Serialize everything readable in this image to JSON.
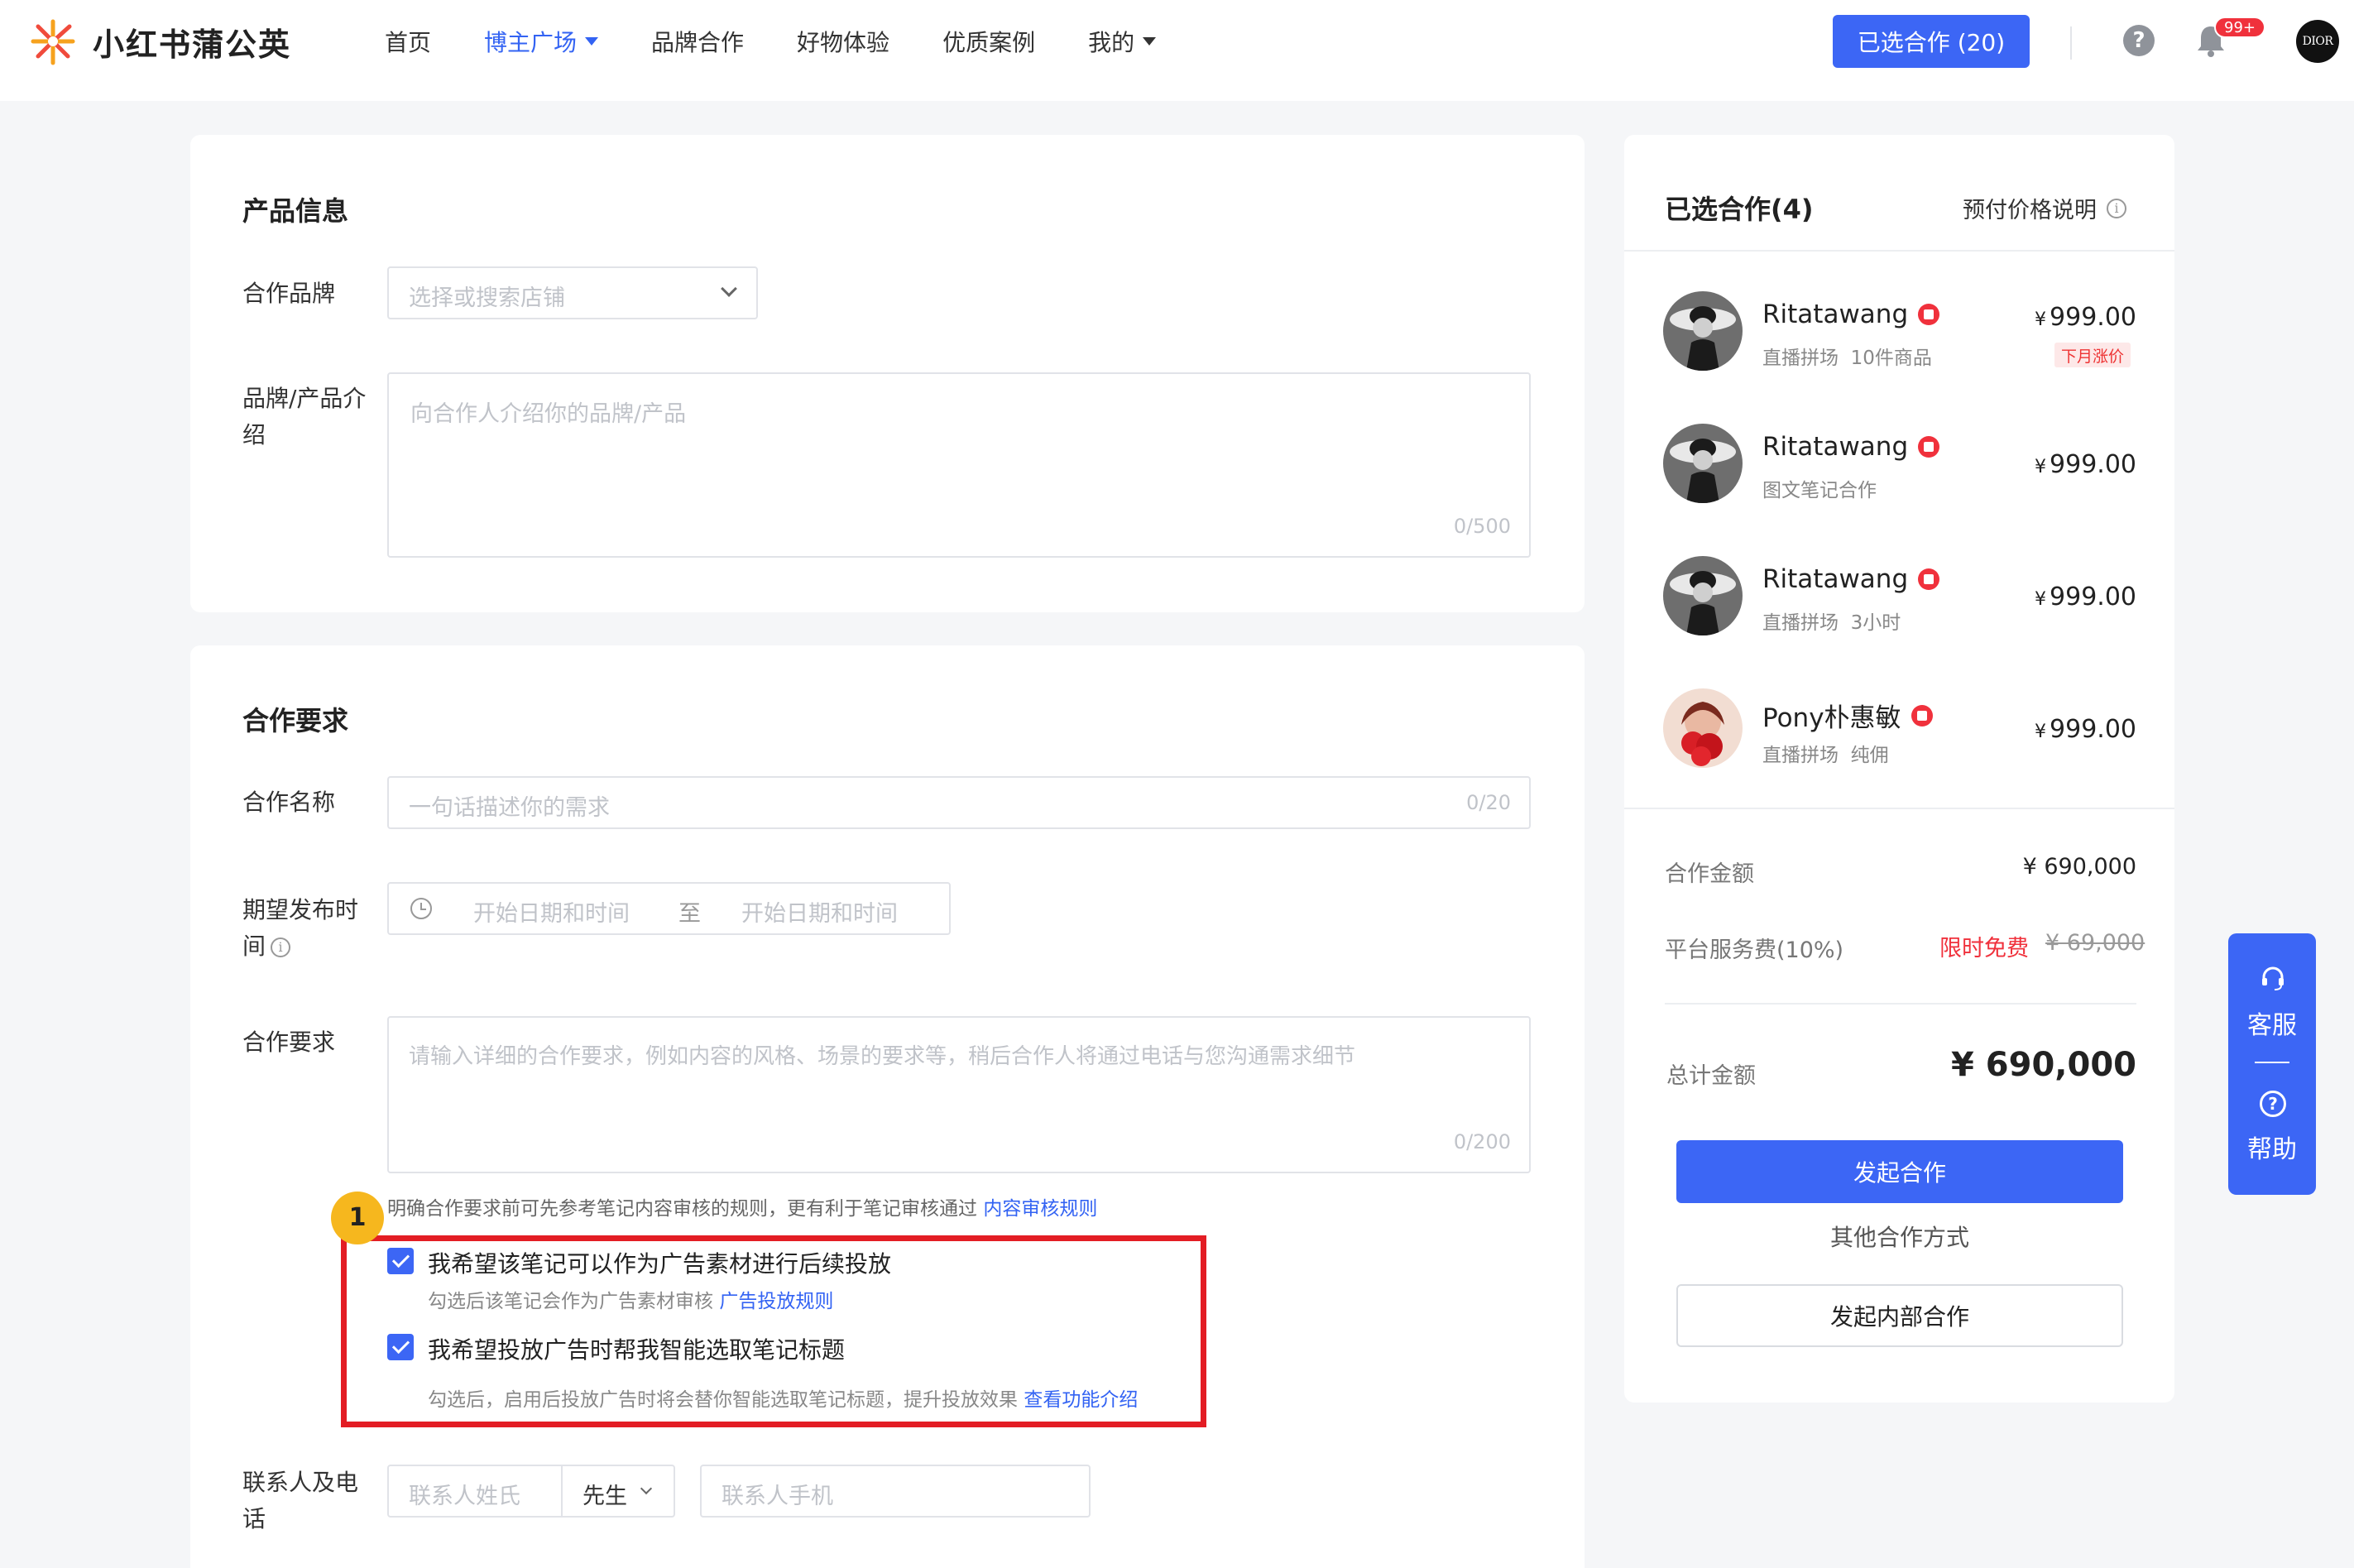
{
  "header": {
    "brand": "小红书蒲公英",
    "nav": [
      {
        "label": "首页",
        "active": false,
        "dropdown": false
      },
      {
        "label": "博主广场",
        "active": true,
        "dropdown": true
      },
      {
        "label": "品牌合作",
        "active": false,
        "dropdown": false
      },
      {
        "label": "好物体验",
        "active": false,
        "dropdown": false
      },
      {
        "label": "优质案例",
        "active": false,
        "dropdown": false
      },
      {
        "label": "我的",
        "active": false,
        "dropdown": true
      }
    ],
    "selected_button": "已选合作 (20)",
    "notification_badge": "99+",
    "help_glyph": "?",
    "avatar_text": "DIOR",
    "icons": [
      "dandelion-logo-icon",
      "help-icon",
      "bell-icon"
    ]
  },
  "product_section": {
    "title": "产品信息",
    "brand_field": {
      "label": "合作品牌",
      "placeholder": "选择或搜索店铺"
    },
    "intro_field": {
      "label": "品牌/产品介绍",
      "placeholder": "向合作人介绍你的品牌/产品",
      "counter": "0/500"
    }
  },
  "requirements_section": {
    "title": "合作要求",
    "name_field": {
      "label": "合作名称",
      "placeholder": "一句话描述你的需求",
      "counter": "0/20"
    },
    "time_field": {
      "label": "期望发布时间",
      "start_placeholder": "开始日期和时间",
      "separator": "至",
      "end_placeholder": "开始日期和时间"
    },
    "req_field": {
      "label": "合作要求",
      "placeholder": "请输入详细的合作要求，例如内容的风格、场景的要求等，稍后合作人将通过电话与您沟通需求细节",
      "counter": "0/200"
    },
    "review_hint": {
      "text": "明确合作要求前可先参考笔记内容审核的规则，更有利于笔记审核通过",
      "link": "内容审核规则"
    },
    "step_number": "1",
    "options": [
      {
        "checked": true,
        "label": "我希望该笔记可以作为广告素材进行后续投放",
        "sub": "勾选后该笔记会作为广告素材审核",
        "link": "广告投放规则"
      },
      {
        "checked": true,
        "label": "我希望投放广告时帮我智能选取笔记标题",
        "sub": "勾选后，启用后投放广告时将会替你智能选取笔记标题，提升投放效果",
        "link": "查看功能介绍"
      }
    ],
    "contact_field": {
      "label": "联系人及电话",
      "name_placeholder": "联系人姓氏",
      "title_value": "先生",
      "phone_placeholder": "联系人手机"
    }
  },
  "side_panel": {
    "title": "已选合作(4)",
    "price_note": "预付价格说明",
    "partners": [
      {
        "name": "Ritatawang",
        "type": "直播拼场",
        "detail": "10件商品",
        "price": "999.00",
        "currency": "¥",
        "tag": "下月涨价",
        "avatar": "bw"
      },
      {
        "name": "Ritatawang",
        "type": "图文笔记合作",
        "detail": "",
        "price": "999.00",
        "currency": "¥",
        "tag": "",
        "avatar": "bw"
      },
      {
        "name": "Ritatawang",
        "type": "直播拼场",
        "detail": "3小时",
        "price": "999.00",
        "currency": "¥",
        "tag": "",
        "avatar": "bw"
      },
      {
        "name": "Pony朴惠敏",
        "type": "直播拼场",
        "detail": "纯佣",
        "price": "999.00",
        "currency": "¥",
        "tag": "",
        "avatar": "red"
      }
    ],
    "amount_label": "合作金额",
    "amount_value": "¥ 690,000",
    "fee_label": "平台服务费(10%)",
    "fee_promo": "限时免费",
    "fee_original": "¥ 69,000",
    "total_label": "总计金额",
    "total_value": "¥ 690,000",
    "primary_button": "发起合作",
    "other_ways": "其他合作方式",
    "internal_button": "发起内部合作"
  },
  "float_panel": {
    "service_label": "客服",
    "help_label": "帮助",
    "help_glyph": "?"
  },
  "colors": {
    "accent": "#3c66f5",
    "link": "#3363f3",
    "highlight_box": "#e31d24",
    "badge": "#f6b71e",
    "promo": "#f0313c"
  }
}
